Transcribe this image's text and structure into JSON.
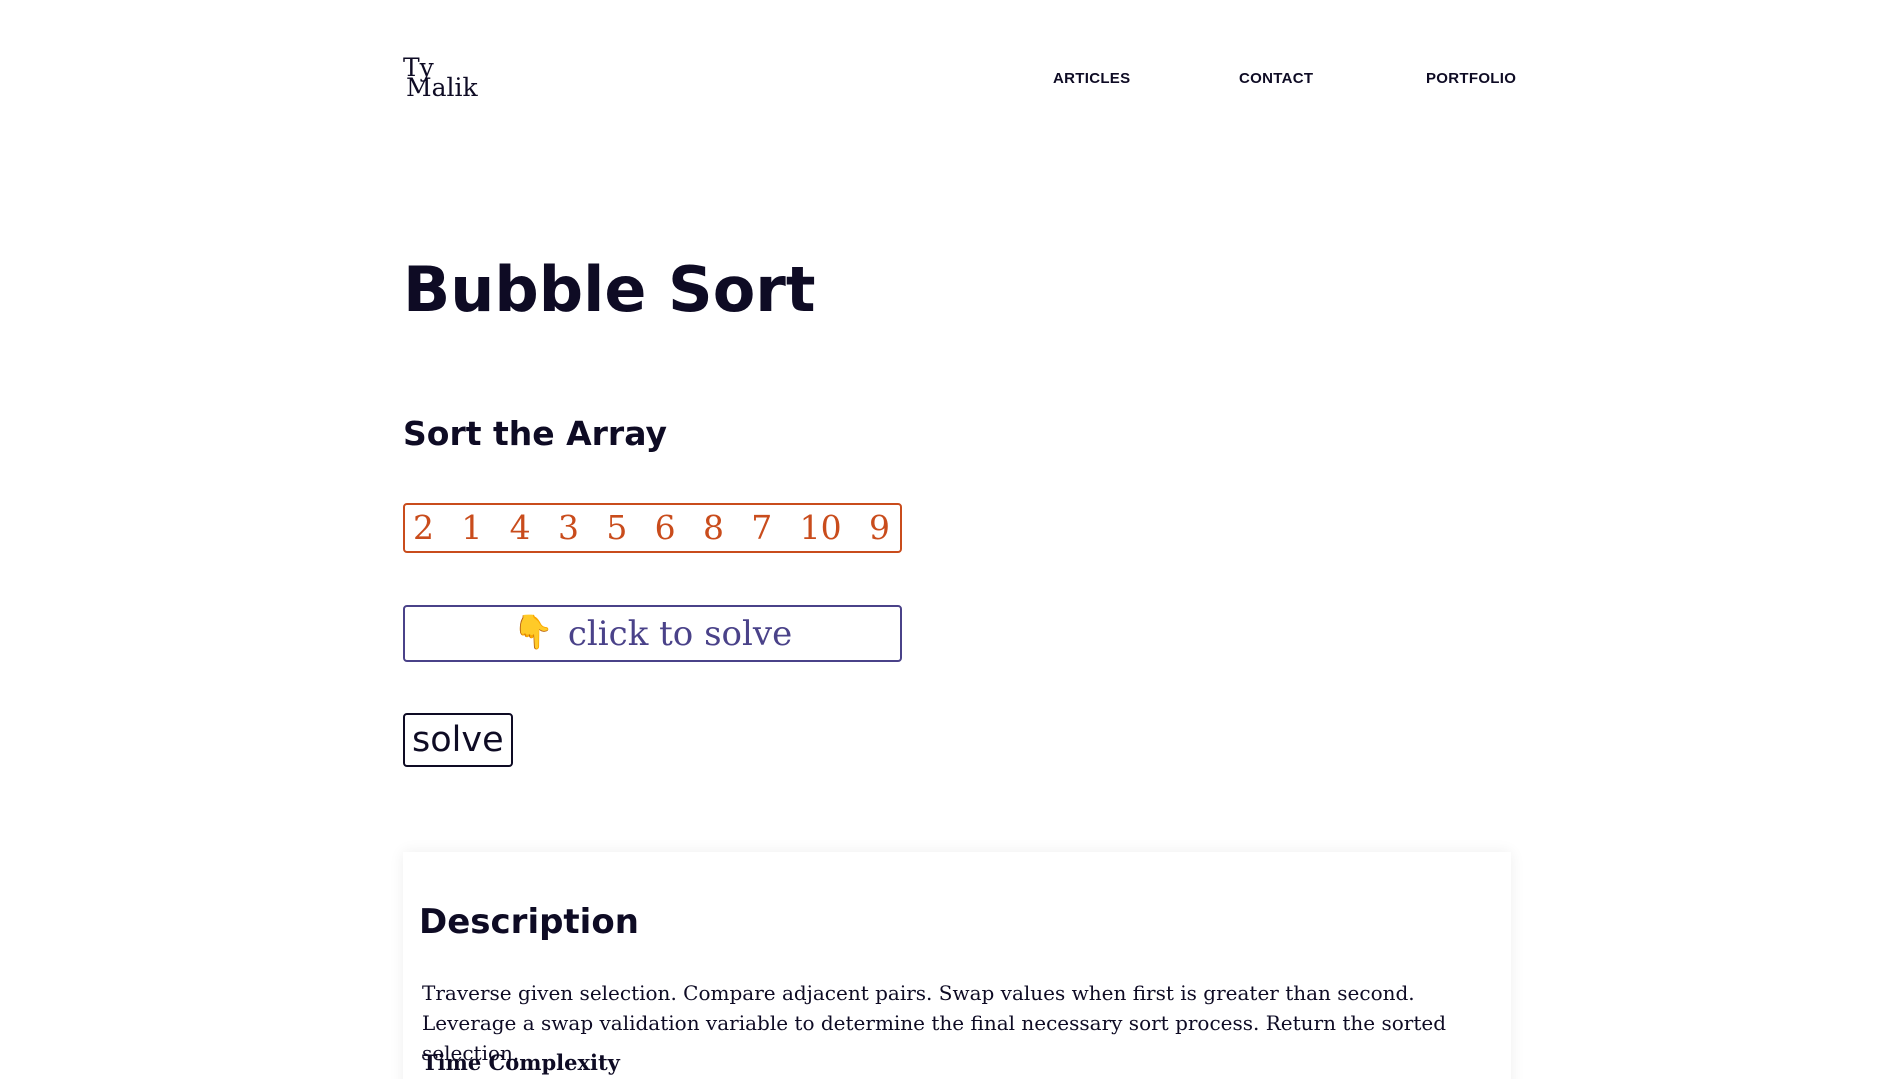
{
  "header": {
    "logo_line1": "Ty",
    "logo_line2": "Malik",
    "nav": [
      "ARTICLES",
      "CONTACT",
      "PORTFOLIO"
    ]
  },
  "main": {
    "title": "Bubble Sort",
    "section_title": "Sort the Array",
    "array": [
      "2",
      "1",
      "4",
      "3",
      "5",
      "6",
      "8",
      "7",
      "10",
      "9"
    ],
    "hint_icon": "👇",
    "hint_text": "click to solve",
    "solve_label": "solve"
  },
  "description": {
    "title": "Description",
    "text": "Traverse given selection. Compare adjacent pairs. Swap values when first is greater than second. Leverage a swap validation variable to determine the final necessary sort process. Return the sorted selection.",
    "subtitle": "Time Complexity"
  },
  "colors": {
    "text": "#0e0b24",
    "array_accent": "#c94c1c",
    "hint_accent": "#4a4289"
  }
}
